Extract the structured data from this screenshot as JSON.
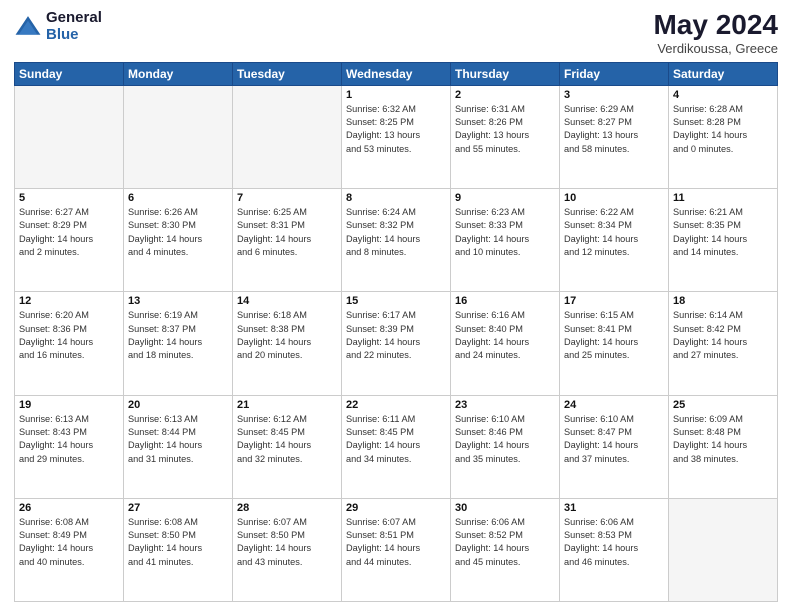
{
  "header": {
    "logo_line1": "General",
    "logo_line2": "Blue",
    "month_title": "May 2024",
    "location": "Verdikoussa, Greece"
  },
  "weekdays": [
    "Sunday",
    "Monday",
    "Tuesday",
    "Wednesday",
    "Thursday",
    "Friday",
    "Saturday"
  ],
  "weeks": [
    [
      {
        "day": "",
        "info": ""
      },
      {
        "day": "",
        "info": ""
      },
      {
        "day": "",
        "info": ""
      },
      {
        "day": "1",
        "info": "Sunrise: 6:32 AM\nSunset: 8:25 PM\nDaylight: 13 hours\nand 53 minutes."
      },
      {
        "day": "2",
        "info": "Sunrise: 6:31 AM\nSunset: 8:26 PM\nDaylight: 13 hours\nand 55 minutes."
      },
      {
        "day": "3",
        "info": "Sunrise: 6:29 AM\nSunset: 8:27 PM\nDaylight: 13 hours\nand 58 minutes."
      },
      {
        "day": "4",
        "info": "Sunrise: 6:28 AM\nSunset: 8:28 PM\nDaylight: 14 hours\nand 0 minutes."
      }
    ],
    [
      {
        "day": "5",
        "info": "Sunrise: 6:27 AM\nSunset: 8:29 PM\nDaylight: 14 hours\nand 2 minutes."
      },
      {
        "day": "6",
        "info": "Sunrise: 6:26 AM\nSunset: 8:30 PM\nDaylight: 14 hours\nand 4 minutes."
      },
      {
        "day": "7",
        "info": "Sunrise: 6:25 AM\nSunset: 8:31 PM\nDaylight: 14 hours\nand 6 minutes."
      },
      {
        "day": "8",
        "info": "Sunrise: 6:24 AM\nSunset: 8:32 PM\nDaylight: 14 hours\nand 8 minutes."
      },
      {
        "day": "9",
        "info": "Sunrise: 6:23 AM\nSunset: 8:33 PM\nDaylight: 14 hours\nand 10 minutes."
      },
      {
        "day": "10",
        "info": "Sunrise: 6:22 AM\nSunset: 8:34 PM\nDaylight: 14 hours\nand 12 minutes."
      },
      {
        "day": "11",
        "info": "Sunrise: 6:21 AM\nSunset: 8:35 PM\nDaylight: 14 hours\nand 14 minutes."
      }
    ],
    [
      {
        "day": "12",
        "info": "Sunrise: 6:20 AM\nSunset: 8:36 PM\nDaylight: 14 hours\nand 16 minutes."
      },
      {
        "day": "13",
        "info": "Sunrise: 6:19 AM\nSunset: 8:37 PM\nDaylight: 14 hours\nand 18 minutes."
      },
      {
        "day": "14",
        "info": "Sunrise: 6:18 AM\nSunset: 8:38 PM\nDaylight: 14 hours\nand 20 minutes."
      },
      {
        "day": "15",
        "info": "Sunrise: 6:17 AM\nSunset: 8:39 PM\nDaylight: 14 hours\nand 22 minutes."
      },
      {
        "day": "16",
        "info": "Sunrise: 6:16 AM\nSunset: 8:40 PM\nDaylight: 14 hours\nand 24 minutes."
      },
      {
        "day": "17",
        "info": "Sunrise: 6:15 AM\nSunset: 8:41 PM\nDaylight: 14 hours\nand 25 minutes."
      },
      {
        "day": "18",
        "info": "Sunrise: 6:14 AM\nSunset: 8:42 PM\nDaylight: 14 hours\nand 27 minutes."
      }
    ],
    [
      {
        "day": "19",
        "info": "Sunrise: 6:13 AM\nSunset: 8:43 PM\nDaylight: 14 hours\nand 29 minutes."
      },
      {
        "day": "20",
        "info": "Sunrise: 6:13 AM\nSunset: 8:44 PM\nDaylight: 14 hours\nand 31 minutes."
      },
      {
        "day": "21",
        "info": "Sunrise: 6:12 AM\nSunset: 8:45 PM\nDaylight: 14 hours\nand 32 minutes."
      },
      {
        "day": "22",
        "info": "Sunrise: 6:11 AM\nSunset: 8:45 PM\nDaylight: 14 hours\nand 34 minutes."
      },
      {
        "day": "23",
        "info": "Sunrise: 6:10 AM\nSunset: 8:46 PM\nDaylight: 14 hours\nand 35 minutes."
      },
      {
        "day": "24",
        "info": "Sunrise: 6:10 AM\nSunset: 8:47 PM\nDaylight: 14 hours\nand 37 minutes."
      },
      {
        "day": "25",
        "info": "Sunrise: 6:09 AM\nSunset: 8:48 PM\nDaylight: 14 hours\nand 38 minutes."
      }
    ],
    [
      {
        "day": "26",
        "info": "Sunrise: 6:08 AM\nSunset: 8:49 PM\nDaylight: 14 hours\nand 40 minutes."
      },
      {
        "day": "27",
        "info": "Sunrise: 6:08 AM\nSunset: 8:50 PM\nDaylight: 14 hours\nand 41 minutes."
      },
      {
        "day": "28",
        "info": "Sunrise: 6:07 AM\nSunset: 8:50 PM\nDaylight: 14 hours\nand 43 minutes."
      },
      {
        "day": "29",
        "info": "Sunrise: 6:07 AM\nSunset: 8:51 PM\nDaylight: 14 hours\nand 44 minutes."
      },
      {
        "day": "30",
        "info": "Sunrise: 6:06 AM\nSunset: 8:52 PM\nDaylight: 14 hours\nand 45 minutes."
      },
      {
        "day": "31",
        "info": "Sunrise: 6:06 AM\nSunset: 8:53 PM\nDaylight: 14 hours\nand 46 minutes."
      },
      {
        "day": "",
        "info": ""
      }
    ]
  ]
}
